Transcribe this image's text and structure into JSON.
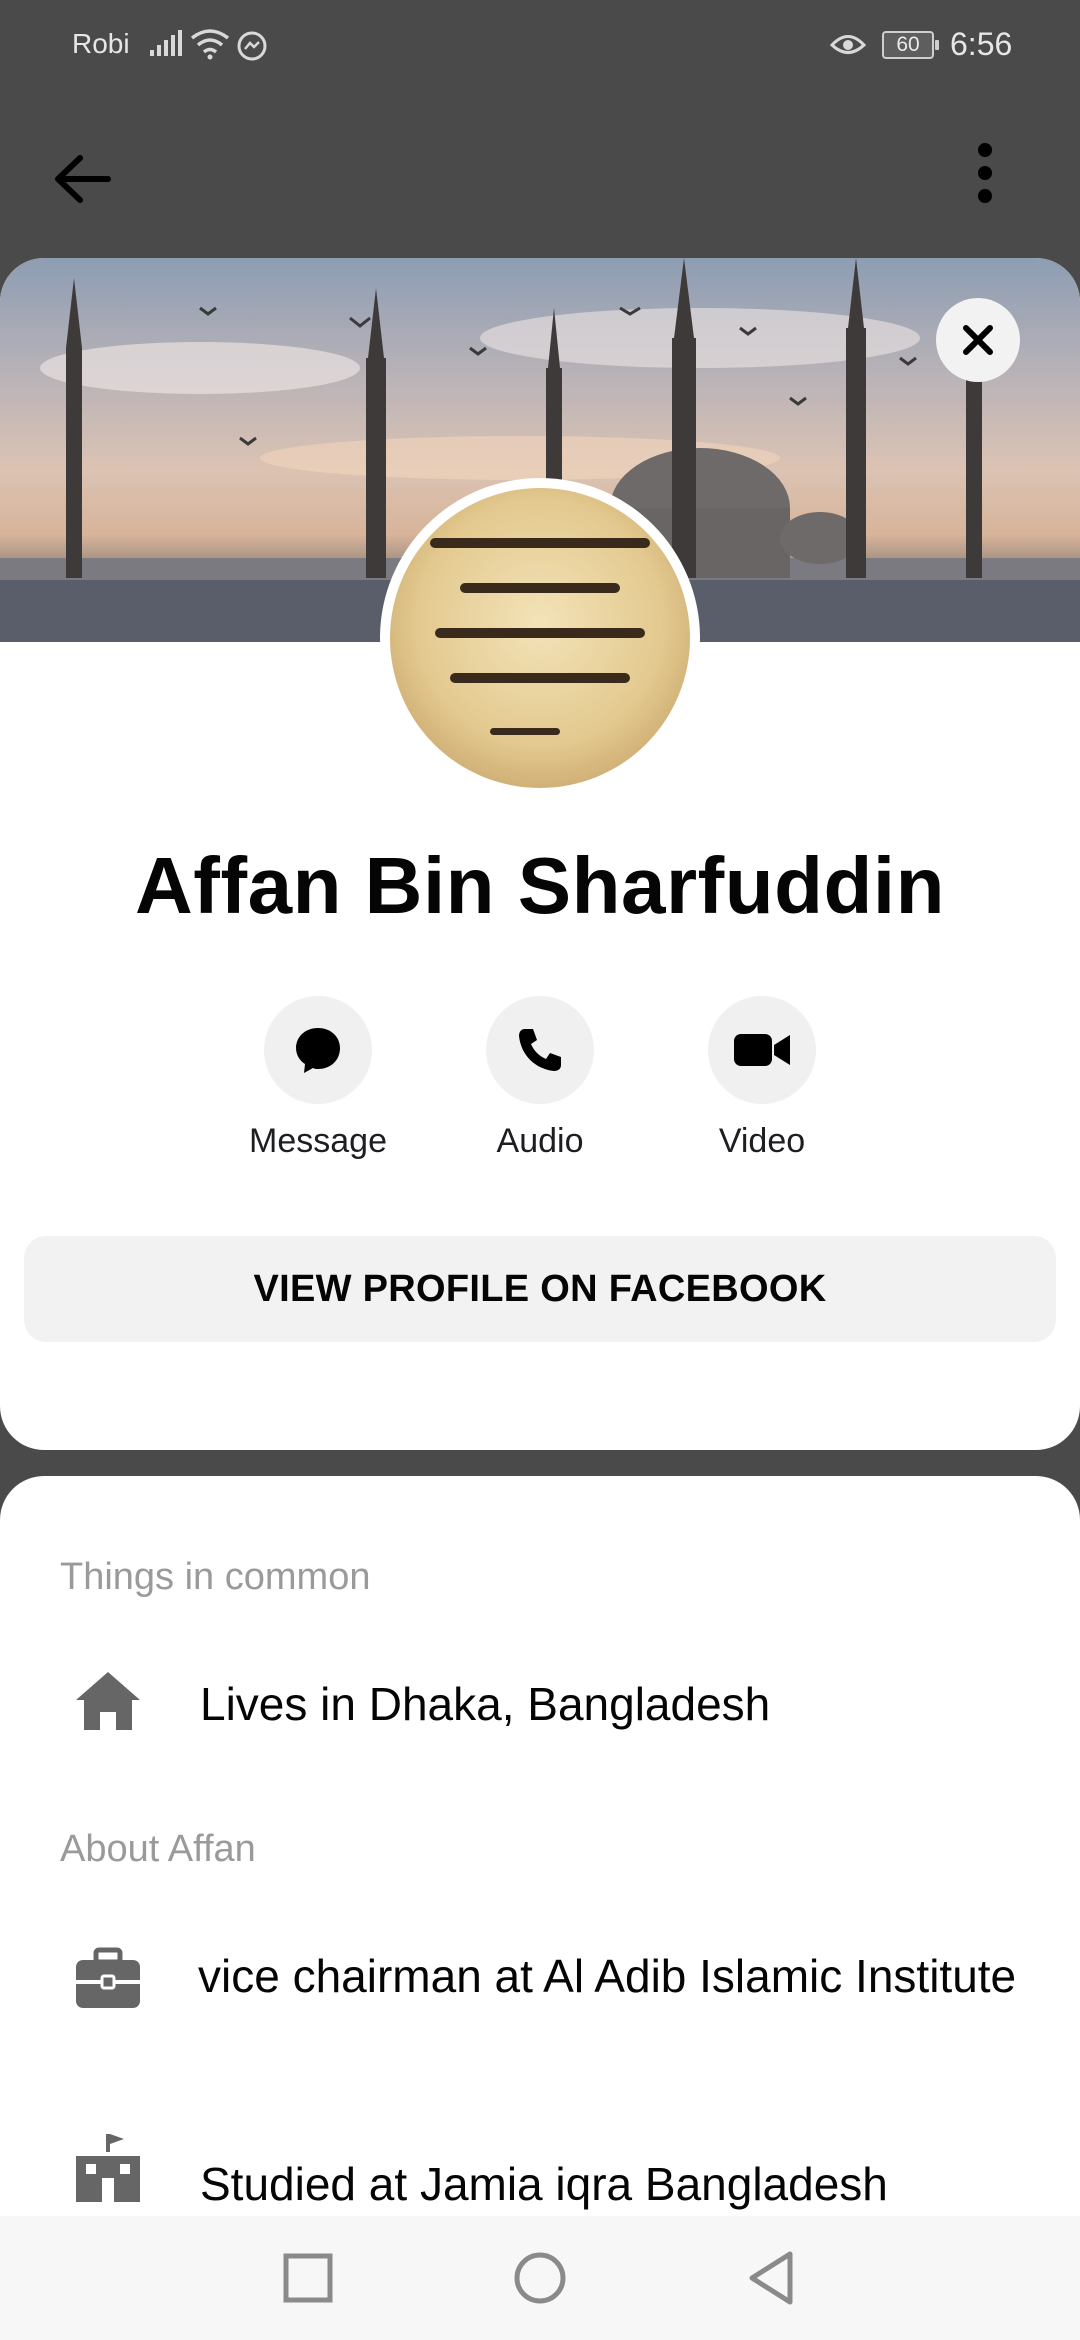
{
  "status_bar": {
    "carrier": "Robi",
    "battery": "60",
    "time": "6:56"
  },
  "topbar": {
    "back_icon": "arrow-left-icon",
    "more_icon": "more-vertical-icon"
  },
  "profile": {
    "name": "Affan Bin Sharfuddin",
    "actions": [
      {
        "label": "Message",
        "icon": "messenger-bubble-icon"
      },
      {
        "label": "Audio",
        "icon": "phone-icon"
      },
      {
        "label": "Video",
        "icon": "video-camera-icon"
      }
    ],
    "view_profile_label": "VIEW PROFILE ON FACEBOOK"
  },
  "sheet": {
    "common_title": "Things in common",
    "common_items": [
      {
        "icon": "home-icon",
        "text": "Lives in Dhaka, Bangladesh"
      }
    ],
    "about_title": "About Affan",
    "about_items": [
      {
        "icon": "briefcase-icon",
        "text": "vice chairman at Al Adib Islamic Institute"
      },
      {
        "icon": "school-icon",
        "text": "Studied at Jamia iqra Bangladesh"
      }
    ]
  },
  "navbar": {
    "recents_icon": "square-icon",
    "home_icon": "circle-icon",
    "back_icon": "triangle-back-icon"
  },
  "colors": {
    "background": "#4a4a4a",
    "card": "#ffffff",
    "button_bg": "#f2f2f2",
    "section_title": "#9a9a9a"
  }
}
